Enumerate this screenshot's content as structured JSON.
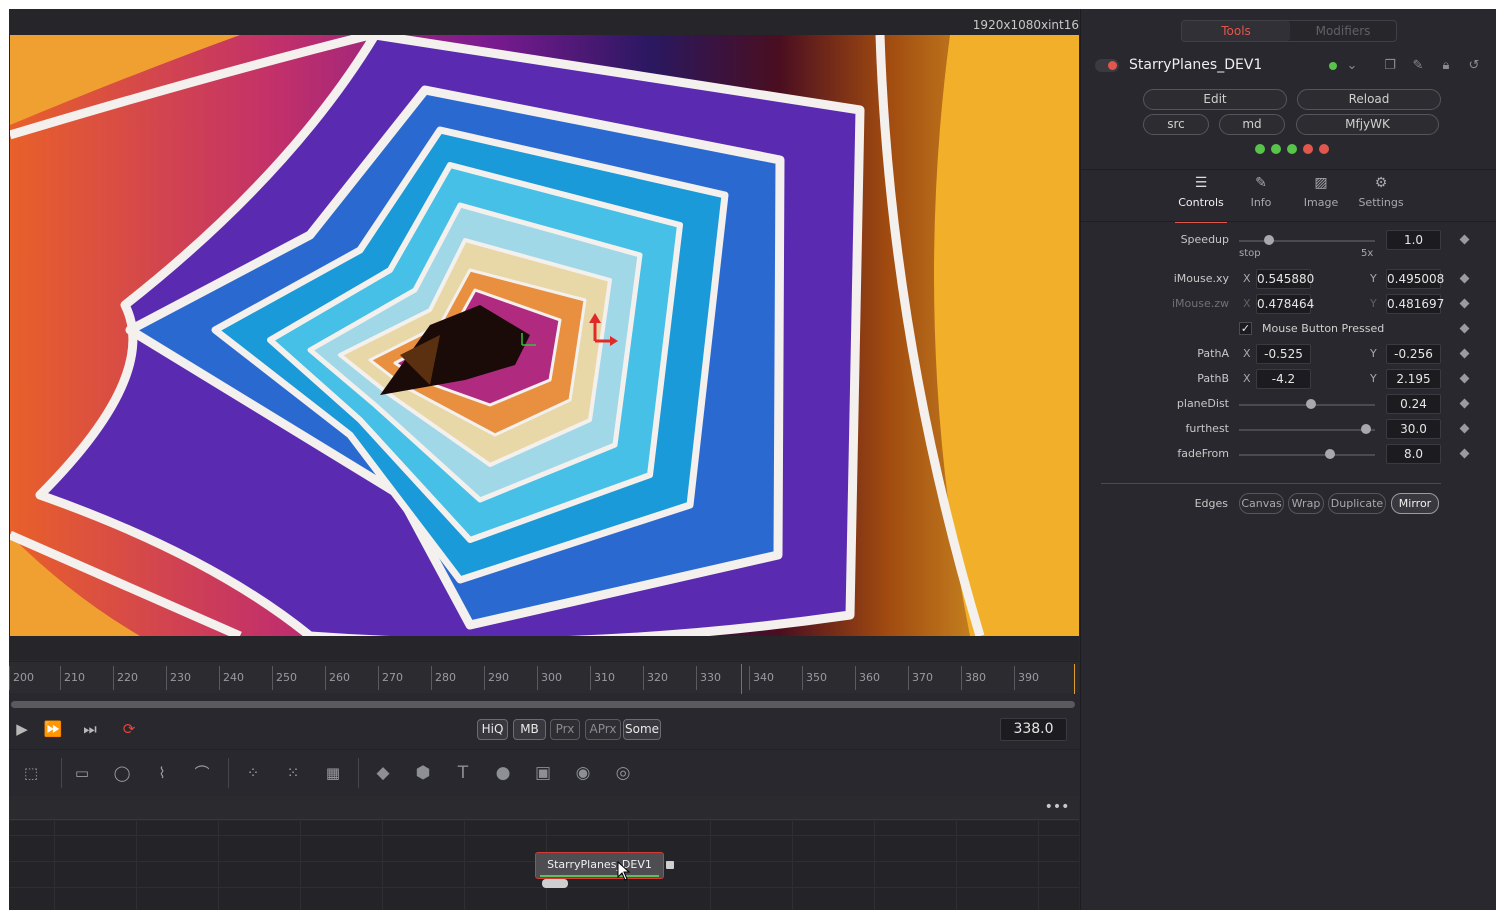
{
  "viewer": {
    "resolution": "1920x1080xint16"
  },
  "timeline": {
    "ticks": [
      "200",
      "210",
      "220",
      "230",
      "240",
      "250",
      "260",
      "270",
      "280",
      "290",
      "300",
      "310",
      "320",
      "330",
      "340",
      "350",
      "360",
      "370",
      "380",
      "390"
    ],
    "current_frame": "338.0"
  },
  "transport": {
    "play": "▶",
    "fast_forward": "⏩",
    "skip_end": "⏭",
    "loop": "⟳",
    "quality": {
      "hiq": "HiQ",
      "mb": "MB",
      "prx": "Prx",
      "aprx": "APrx",
      "some": "Some"
    }
  },
  "node_editor": {
    "node_label": "StarryPlanes_DEV1",
    "more": "•••"
  },
  "inspector": {
    "tabs_top": {
      "tools": "Tools",
      "modifiers": "Modifiers"
    },
    "tool_name": "StarryPlanes_DEV1",
    "buttons": {
      "edit": "Edit",
      "reload": "Reload",
      "src": "src",
      "md": "md",
      "mfjywk": "MfjyWK"
    },
    "leds": [
      "#58c44a",
      "#58c44a",
      "#58c44a",
      "#e2574c",
      "#e2574c"
    ],
    "tabs": {
      "controls": "Controls",
      "info": "Info",
      "image": "Image",
      "settings": "Settings"
    },
    "params": {
      "speedup": {
        "label": "Speedup",
        "value": "1.0",
        "min_label": "stop",
        "max_label": "5x",
        "level": 0.2
      },
      "imouse_xy": {
        "label": "iMouse.xy",
        "x_label": "X",
        "y_label": "Y",
        "x": "0.545880",
        "y": "0.495008"
      },
      "imouse_zw": {
        "label": "iMouse.zw",
        "x_label": "X",
        "y_label": "Y",
        "x": "0.478464",
        "y": "0.481697"
      },
      "mouse_button": {
        "label": "Mouse Button Pressed",
        "check": "✓"
      },
      "path_a": {
        "label": "PathA",
        "x_label": "X",
        "y_label": "Y",
        "x": "-0.525",
        "y": "-0.256"
      },
      "path_b": {
        "label": "PathB",
        "x_label": "X",
        "y_label": "Y",
        "x": "-4.2",
        "y": "2.195"
      },
      "plane_dist": {
        "label": "planeDist",
        "value": "0.24",
        "level": 0.53
      },
      "furthest": {
        "label": "furthest",
        "value": "30.0",
        "level": 0.97
      },
      "fade_from": {
        "label": "fadeFrom",
        "value": "8.0",
        "level": 0.68
      },
      "edges": {
        "label": "Edges",
        "options": [
          "Canvas",
          "Wrap",
          "Duplicate",
          "Mirror"
        ],
        "selected": "Mirror"
      }
    }
  },
  "colors": {
    "accent": "#e2574c",
    "ok": "#58c44a",
    "bg": "#28282e"
  }
}
